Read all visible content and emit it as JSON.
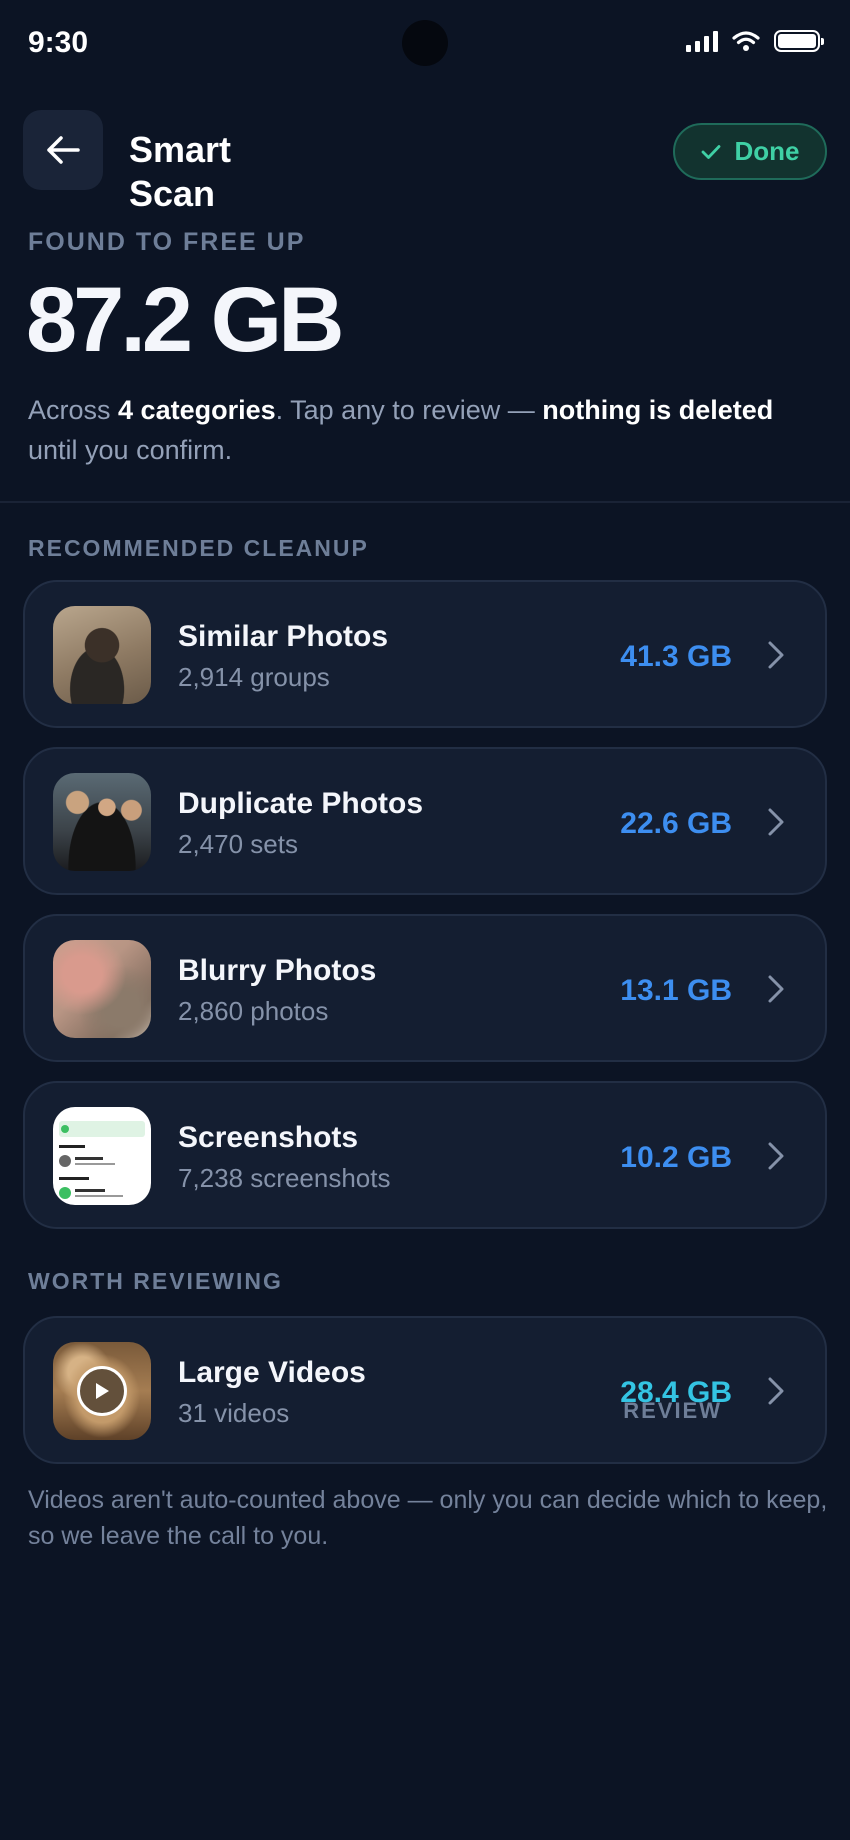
{
  "status_bar": {
    "time": "9:30"
  },
  "header": {
    "title": "Smart Scan",
    "done_label": "Done"
  },
  "summary": {
    "found_label": "FOUND TO FREE UP",
    "total": "87.2 GB",
    "text_1": "Across ",
    "categories_bold": "4 categories",
    "text_2": ". Tap any to review — ",
    "nothing_bold": "nothing is deleted",
    "text_3": " until you confirm."
  },
  "recommended": {
    "label": "RECOMMENDED CLEANUP",
    "items": [
      {
        "title": "Similar Photos",
        "sub": "2,914 groups",
        "size": "41.3 GB"
      },
      {
        "title": "Duplicate Photos",
        "sub": "2,470 sets",
        "size": "22.6 GB"
      },
      {
        "title": "Blurry Photos",
        "sub": "2,860 photos",
        "size": "13.1 GB"
      },
      {
        "title": "Screenshots",
        "sub": "7,238 screenshots",
        "size": "10.2 GB"
      }
    ]
  },
  "reviewing": {
    "label": "WORTH REVIEWING",
    "item": {
      "title": "Large Videos",
      "sub": "31 videos",
      "size": "28.4 GB",
      "tag": "REVIEW"
    }
  },
  "footnote": "Videos aren't auto-counted above — only you can decide which to keep, so we leave the call to you.",
  "colors": {
    "background": "#0c1424",
    "accent_blue": "#3d8ef0",
    "accent_green": "#3fd0a5",
    "accent_teal": "#34c4e3"
  }
}
